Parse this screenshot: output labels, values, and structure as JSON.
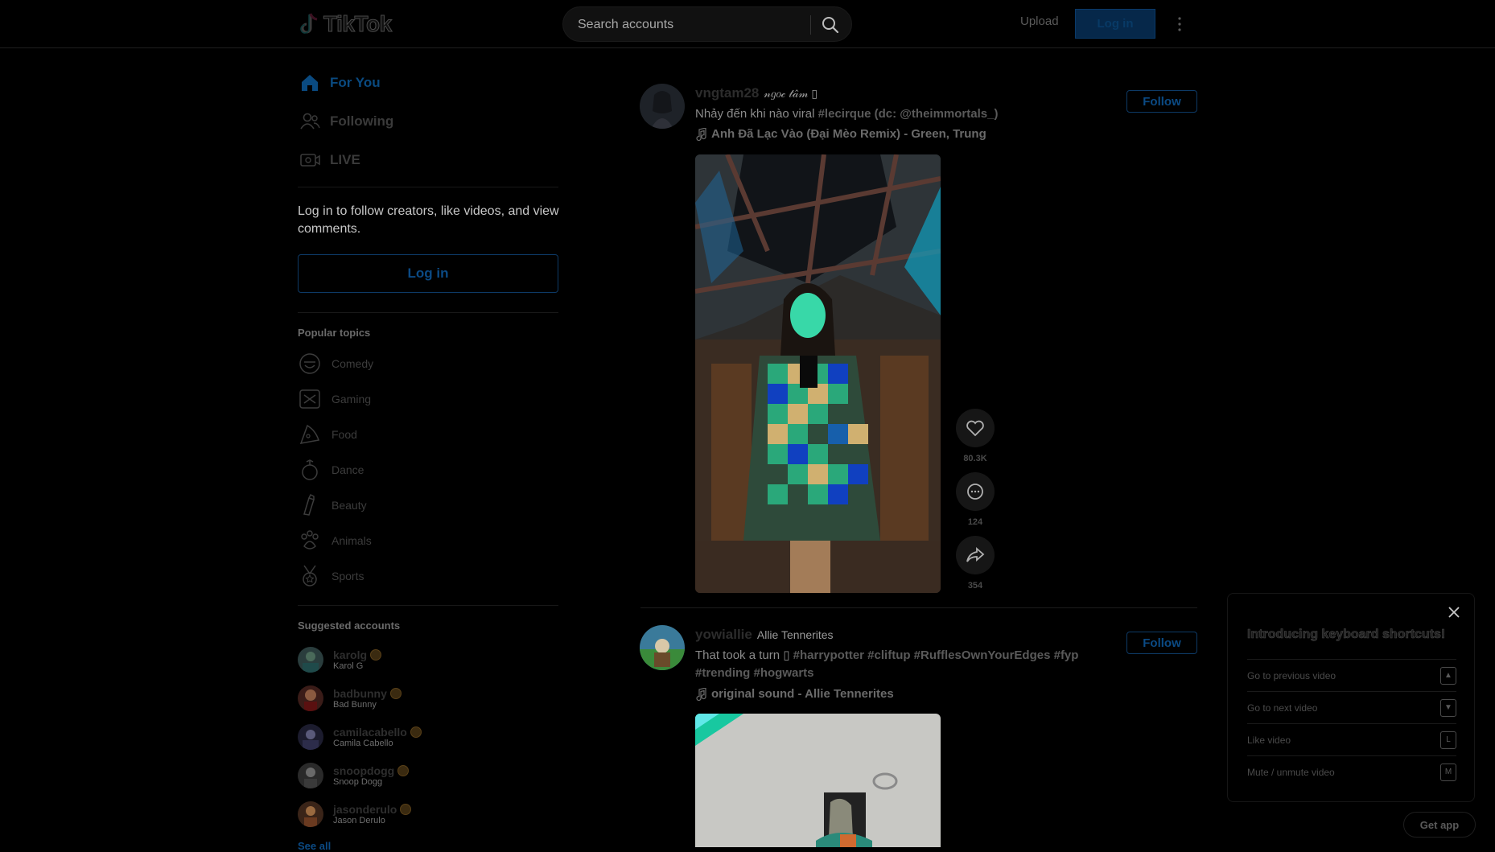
{
  "header": {
    "logo_text": "TikTok",
    "search_placeholder": "Search accounts",
    "upload_label": "Upload",
    "login_label": "Log in"
  },
  "sidebar": {
    "nav": [
      {
        "label": "For You",
        "icon": "home-icon",
        "active": true
      },
      {
        "label": "Following",
        "icon": "people-icon",
        "active": false
      },
      {
        "label": "LIVE",
        "icon": "live-icon",
        "active": false
      }
    ],
    "login_prompt": "Log in to follow creators, like videos, and view comments.",
    "login_button": "Log in",
    "popular_topics_title": "Popular topics",
    "topics": [
      {
        "label": "Comedy",
        "icon": "comedy-icon"
      },
      {
        "label": "Gaming",
        "icon": "gaming-icon"
      },
      {
        "label": "Food",
        "icon": "food-icon"
      },
      {
        "label": "Dance",
        "icon": "dance-icon"
      },
      {
        "label": "Beauty",
        "icon": "beauty-icon"
      },
      {
        "label": "Animals",
        "icon": "animals-icon"
      },
      {
        "label": "Sports",
        "icon": "sports-icon"
      }
    ],
    "suggested_title": "Suggested accounts",
    "accounts": [
      {
        "username": "karolg",
        "display": "Karol G"
      },
      {
        "username": "badbunny",
        "display": "Bad Bunny"
      },
      {
        "username": "camilacabello",
        "display": "Camila Cabello"
      },
      {
        "username": "snoopdogg",
        "display": "Snoop Dogg"
      },
      {
        "username": "jasonderulo",
        "display": "Jason Derulo"
      }
    ],
    "see_all": "See all"
  },
  "posts": [
    {
      "username": "vngtam28",
      "display_name": "𝓃𝑔𝑜𝒸 𝓉𝒶̂𝓂 ▯",
      "description_text": "Nhảy đến khi nào viral ",
      "hashtags": "#lecirque (dc: @theimmortals_)",
      "music": "Anh Đã Lạc Vào (Đại Mèo Remix) - Green, Trung",
      "follow_label": "Follow",
      "likes": "80.3K",
      "comments": "124",
      "shares": "354"
    },
    {
      "username": "yowiallie",
      "display_name": "Allie Tennerites",
      "description_text": "That took a turn ▯ ",
      "hashtags": "#harrypotter #cliftup #RufflesOwnYourEdges #fyp #trending #hogwarts",
      "music": "original sound - Allie Tennerites",
      "follow_label": "Follow"
    }
  ],
  "keyboard_shortcuts": {
    "title": "Introducing keyboard shortcuts!",
    "items": [
      {
        "label": "Go to previous video",
        "key": "▲"
      },
      {
        "label": "Go to next video",
        "key": "▼"
      },
      {
        "label": "Like video",
        "key": "L"
      },
      {
        "label": "Mute / unmute video",
        "key": "M"
      }
    ]
  },
  "get_app_label": "Get app",
  "colors": {
    "background": "#000000",
    "accent": "#0b4a84",
    "text": "#d9d9d9"
  }
}
